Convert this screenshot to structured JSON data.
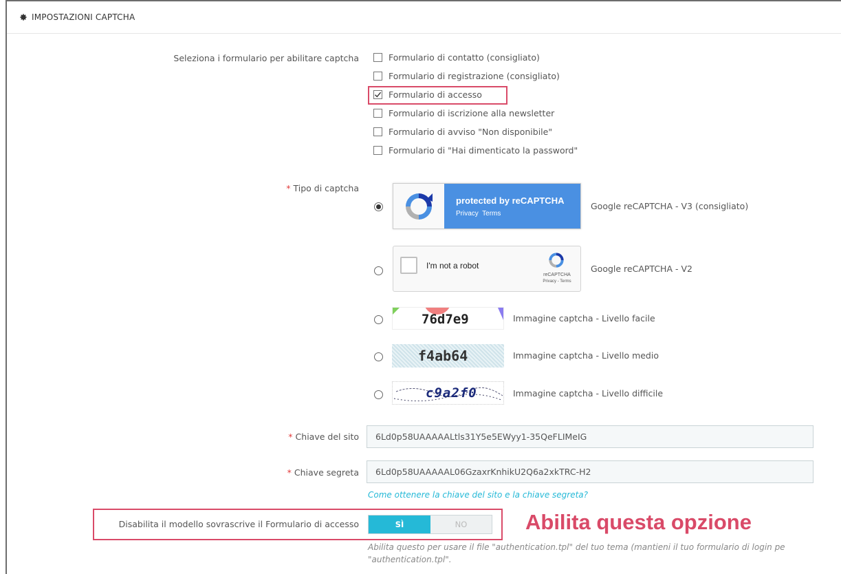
{
  "panel": {
    "title": "IMPOSTAZIONI CAPTCHA",
    "icon": "gear-icon"
  },
  "forms": {
    "label": "Seleziona i formulario per abilitare captcha",
    "options": [
      {
        "label": "Formulario di contatto (consigliato)",
        "checked": false
      },
      {
        "label": "Formulario di registrazione (consigliato)",
        "checked": false
      },
      {
        "label": "Formulario di accesso",
        "checked": true
      },
      {
        "label": "Formulario di iscrizione alla newsletter",
        "checked": false
      },
      {
        "label": "Formulario di avviso \"Non disponibile\"",
        "checked": false
      },
      {
        "label": "Formulario di \"Hai dimenticato la password\"",
        "checked": false
      }
    ]
  },
  "captcha_type": {
    "required_mark": "*",
    "label": "Tipo di captcha",
    "options": [
      {
        "label": "Google reCAPTCHA - V3 (consigliato)",
        "selected": true,
        "badge_title": "protected by reCAPTCHA",
        "badge_links": "Privacy  Terms"
      },
      {
        "label": "Google reCAPTCHA - V2",
        "selected": false,
        "robot_text": "I'm not a robot",
        "brand": "reCAPTCHA",
        "links": "Privacy - Terms"
      },
      {
        "label": "Immagine captcha - Livello facile",
        "selected": false,
        "code": "76d7e9"
      },
      {
        "label": "Immagine captcha - Livello medio",
        "selected": false,
        "code": "f4ab64"
      },
      {
        "label": "Immagine captcha - Livello difficile",
        "selected": false,
        "code": "c9a2f0"
      }
    ]
  },
  "site_key": {
    "required_mark": "*",
    "label": "Chiave del sito",
    "value": "6Ld0p58UAAAAALtls31Y5e5EWyy1-35QeFLIMeIG"
  },
  "secret_key": {
    "required_mark": "*",
    "label": "Chiave segreta",
    "value": "6Ld0p58UAAAAAL06GzaxrKnhikU2Q6a2xkTRC-H2"
  },
  "help_link": "Come ottenere la chiave del sito e la chiave segreta?",
  "override": {
    "label": "Disabilita il modello sovrascrive il Formulario di accesso",
    "on_label": "SÌ",
    "off_label": "NO",
    "value": "SÌ",
    "help_line1": "Abilita questo per usare il file \"authentication.tpl\" del tuo tema (mantieni il tuo formulario di login pe",
    "help_line2": "\"authentication.tpl\"."
  },
  "annotation": "Abilita questa opzione",
  "colors": {
    "accent": "#25b9d7",
    "highlight": "#d94a68",
    "required": "#e23b3b"
  }
}
